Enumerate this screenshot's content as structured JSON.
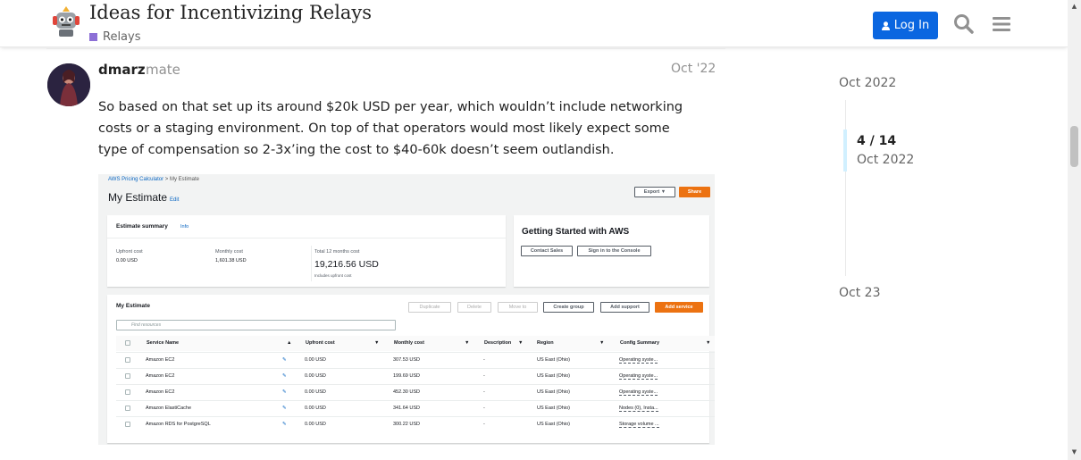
{
  "header": {
    "topic_title": "Ideas for Incentivizing Relays",
    "category": "Relays",
    "category_color": "#8c6fd6",
    "login_label": "Log In",
    "login_color": "#0a66e0",
    "icons": [
      "user-icon",
      "search-icon",
      "hamburger-menu-icon"
    ]
  },
  "post": {
    "username": "dmarz",
    "user_title": "mate",
    "date": "Oct '22",
    "text": "So based on that set up its around $20k USD per year, which wouldn’t include networking costs or a staging environment. On top of that operators would most likely expect some type of compensation so 2-3x’ing the cost to $40-60k doesn’t seem outlandish."
  },
  "estimate_image": {
    "breadcrumb_link": "AWS Pricing Calculator",
    "breadcrumb_current": "My Estimate",
    "heading": "My Estimate",
    "edit_label": "Edit",
    "export_label": "Export",
    "share_label": "Share",
    "summary_title": "Estimate summary",
    "summary_info": "Info",
    "upfront_label": "Upfront cost",
    "upfront_value": "0.00 USD",
    "monthly_label": "Monthly cost",
    "monthly_value": "1,601.38 USD",
    "total_label": "Total 12 months cost",
    "total_value": "19,216.56 USD",
    "total_note": "Includes upfront cost",
    "getting_started": "Getting Started with AWS",
    "contact_sales": "Contact Sales",
    "sign_in_console": "Sign in to the Console",
    "table_title": "My Estimate",
    "duplicate": "Duplicate",
    "delete": "Delete",
    "move_to": "Move to",
    "create_group": "Create group",
    "add_support": "Add support",
    "add_service": "Add service",
    "find_placeholder": "Find resources",
    "columns": [
      "Service Name",
      "Upfront cost",
      "Monthly cost",
      "Description",
      "Region",
      "Config Summary"
    ],
    "rows": [
      {
        "service": "Amazon EC2",
        "upfront": "0.00 USD",
        "monthly": "307.53 USD",
        "desc": "-",
        "region": "US East (Ohio)",
        "config": "Operating syste..."
      },
      {
        "service": "Amazon EC2",
        "upfront": "0.00 USD",
        "monthly": "199.69 USD",
        "desc": "-",
        "region": "US East (Ohio)",
        "config": "Operating syste..."
      },
      {
        "service": "Amazon EC2",
        "upfront": "0.00 USD",
        "monthly": "452.30 USD",
        "desc": "-",
        "region": "US East (Ohio)",
        "config": "Operating syste..."
      },
      {
        "service": "Amazon ElastiCache",
        "upfront": "0.00 USD",
        "monthly": "341.64 USD",
        "desc": "-",
        "region": "US East (Ohio)",
        "config": "Nodes (0), Insta..."
      },
      {
        "service": "Amazon RDS for PostgreSQL",
        "upfront": "0.00 USD",
        "monthly": "300.22 USD",
        "desc": "-",
        "region": "US East (Ohio)",
        "config": "Storage volume ..."
      }
    ]
  },
  "timeline": {
    "top_date": "Oct 2022",
    "position": "4 / 14",
    "position_date": "Oct 2022",
    "bottom_date": "Oct 23"
  }
}
